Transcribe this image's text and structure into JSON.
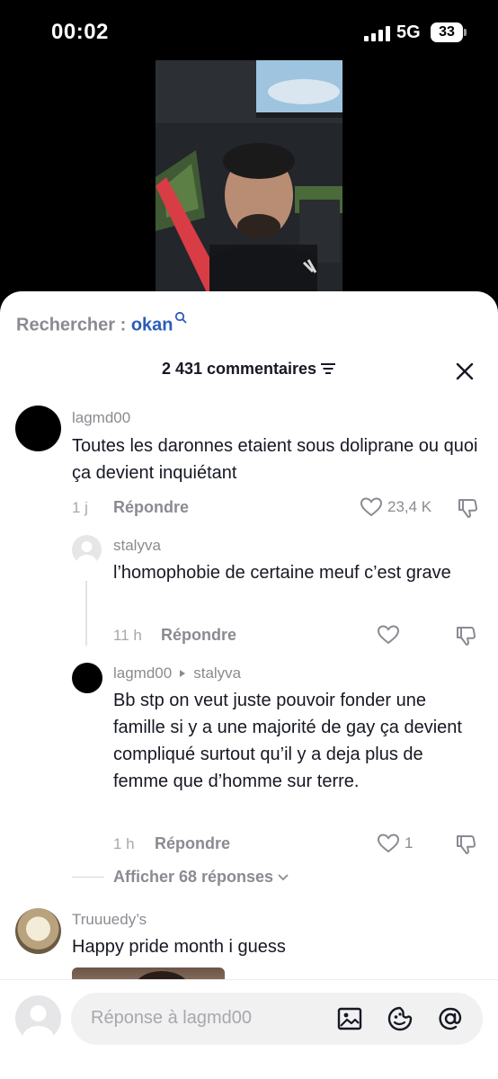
{
  "status": {
    "time": "00:02",
    "network": "5G",
    "battery": "33"
  },
  "search": {
    "prefix": "Rechercher : ",
    "term": "okan"
  },
  "header": {
    "comment_count": "2 431 commentaires"
  },
  "comments": [
    {
      "username": "lagmd00",
      "text": "Toutes les daronnes etaient sous doliprane ou quoi ça devient inquiétant",
      "time": "1 j",
      "reply_label": "Répondre",
      "likes": "23,4 K"
    },
    {
      "username": "stalyva",
      "text": "l’homophobie de certaine meuf c’est grave",
      "time": "11 h",
      "reply_label": "Répondre",
      "likes": ""
    },
    {
      "username": "lagmd00",
      "reply_to": "stalyva",
      "text": "Bb stp on veut juste pouvoir fonder une famille si y a une majorité de gay ça devient compliqué surtout qu’il y a deja plus de femme que d’homme sur terre.",
      "time": "1 h",
      "reply_label": "Répondre",
      "likes": "1"
    },
    {
      "username": "Truuuedy’s",
      "text": "Happy pride month i guess"
    }
  ],
  "more_replies": "Afficher 68 réponses",
  "composer": {
    "placeholder": "Réponse à lagmd00"
  },
  "icons": [
    "search-icon",
    "filter-icon",
    "close-icon",
    "heart-icon",
    "dislike-icon",
    "chevron-down-icon",
    "image-icon",
    "emoji-icon",
    "at-icon"
  ]
}
